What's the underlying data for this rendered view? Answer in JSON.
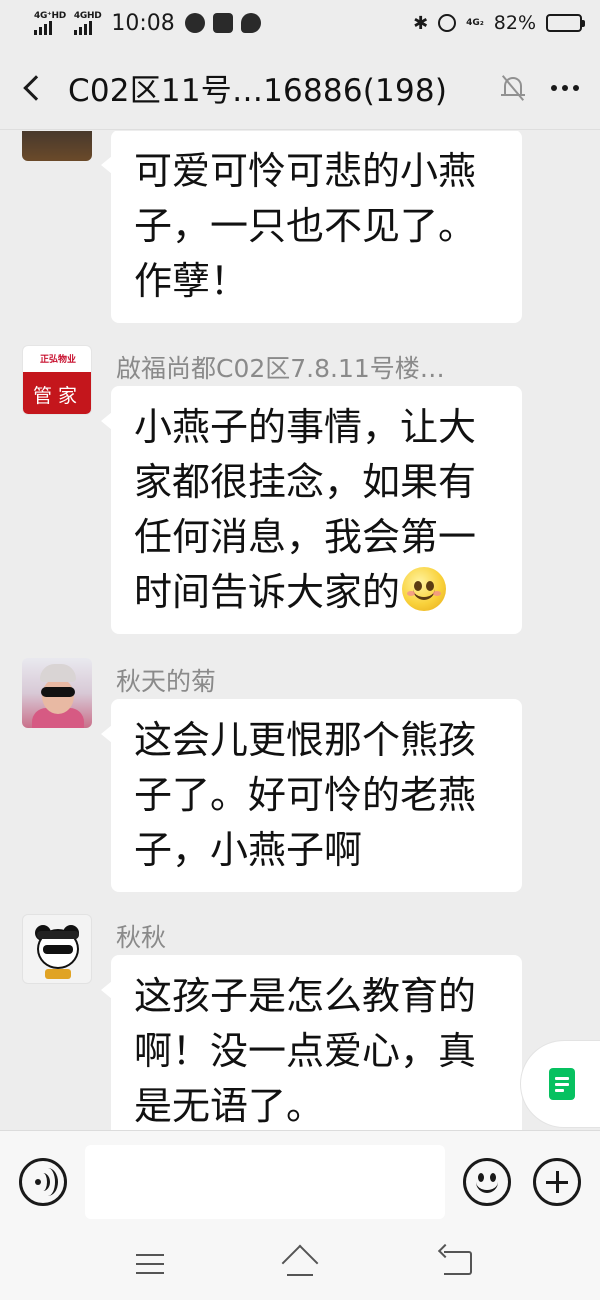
{
  "status_bar": {
    "network_left_1": "4G⁺HD",
    "network_left_2": "4GHD",
    "time": "10:08",
    "network_right": "4G₂",
    "battery_percent": "82%",
    "battery_level": 0.82
  },
  "header": {
    "title": "C02区11号…16886(198)"
  },
  "messages": [
    {
      "sender": "",
      "text": "可爱可怜可悲的小燕子，一只也不见了。作孽！"
    },
    {
      "sender": "啟福尚都C02区7.8.11号楼…",
      "avatar_logo": "正弘物业",
      "avatar_text": "管家",
      "text": "小燕子的事情，让大家都很挂念，如果有任何消息，我会第一时间告诉大家的"
    },
    {
      "sender": "秋天的菊",
      "text": "这会儿更恨那个熊孩子了。好可怜的老燕子，小燕子啊"
    },
    {
      "sender": "秋秋",
      "text": "这孩子是怎么教育的啊！没一点爱心，真是无语了。"
    }
  ],
  "input": {
    "value": "",
    "placeholder": ""
  },
  "icons": {
    "back": "back-icon",
    "mute": "bell-off-icon",
    "more": "more-icon",
    "voice": "voice-icon",
    "emoji": "emoji-icon",
    "plus": "plus-icon",
    "doc": "doc-icon"
  },
  "colors": {
    "background": "#ededed",
    "bubble": "#ffffff",
    "accent_green": "#07c160",
    "logo_red": "#c4161c"
  }
}
